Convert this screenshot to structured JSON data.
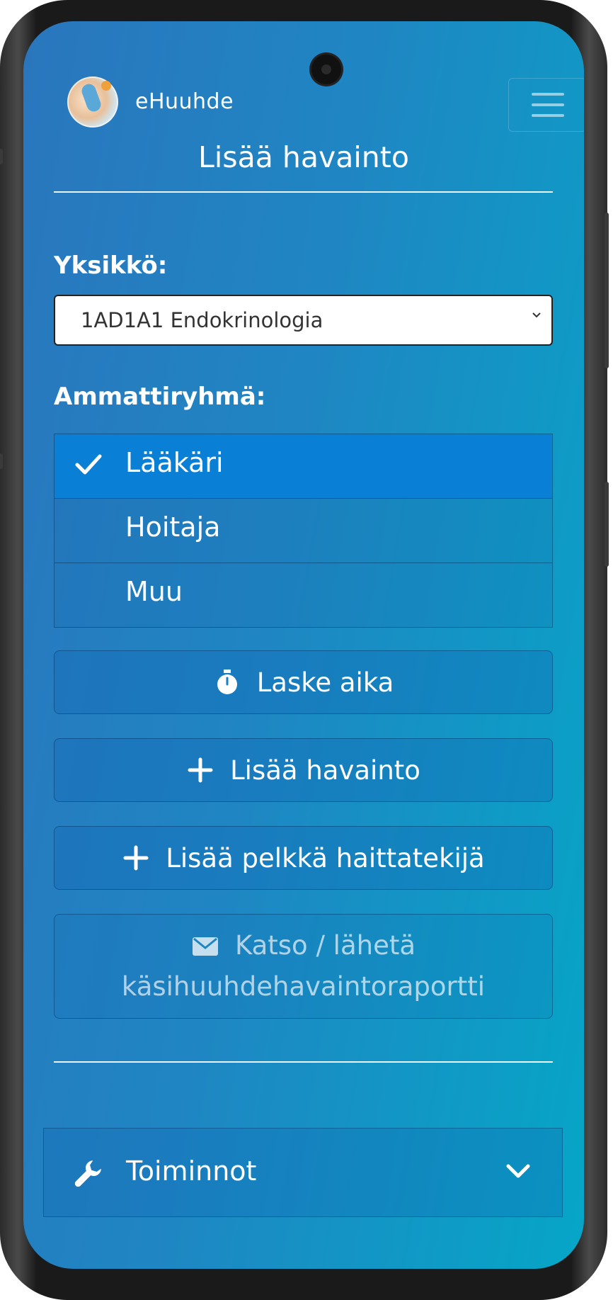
{
  "app": {
    "brand": "eHuuhde"
  },
  "page": {
    "title": "Lisää havainto"
  },
  "unit": {
    "label": "Yksikkö:",
    "selected": "1AD1A1 Endokrinologia"
  },
  "profession": {
    "label": "Ammattiryhmä:",
    "options": [
      {
        "label": "Lääkäri",
        "selected": true
      },
      {
        "label": "Hoitaja",
        "selected": false
      },
      {
        "label": "Muu",
        "selected": false
      }
    ]
  },
  "actions": {
    "timer_label": "Laske aika",
    "add_observation_label": "Lisää havainto",
    "add_risk_factor_label": "Lisää pelkkä haittatekijä",
    "report_label_line1": "Katso / lähetä",
    "report_label_line2": "käsihuuhdehavaintoraportti"
  },
  "functions": {
    "label": "Toiminnot"
  },
  "icons": [
    "app-logo-icon",
    "menu-icon",
    "chevron-down-icon",
    "check-icon",
    "stopwatch-icon",
    "plus-icon",
    "envelope-icon",
    "wrench-icon"
  ],
  "colors": {
    "active_option": "#0a7fd6",
    "gradient_start": "#2a76bd",
    "gradient_end": "#06a6c7"
  }
}
